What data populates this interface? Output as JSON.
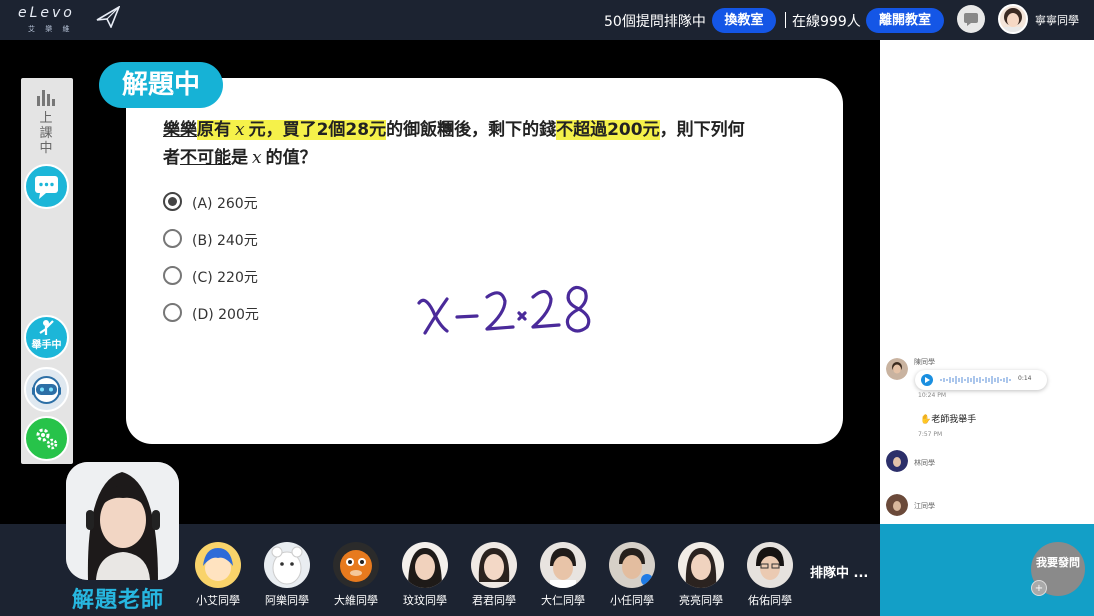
{
  "topbar": {
    "logo_text": "eLevo",
    "logo_sub": "艾 樂 維",
    "queue_text": "50個提問排隊中",
    "switch_button": "換教室",
    "online_text": "在線999人",
    "leave_button": "離開教室",
    "user_name": "寧寧同學"
  },
  "toolstrip": {
    "status_text": "上課中",
    "hand_label": "舉手中"
  },
  "question": {
    "badge": "解題中",
    "part1": "樂樂",
    "part2": "原有",
    "var1": "x",
    "part3": "元，買了",
    "part4": "2個28元",
    "part5": "的御飯糰後，剩下的錢",
    "part6": "不超過200元",
    "part7": "，則下列何",
    "part8": "者",
    "part9": "不可能",
    "part10": "是",
    "var2": "x",
    "part11": "的值？",
    "options": [
      {
        "label": "(A) 260元",
        "selected": true
      },
      {
        "label": "(B) 240元",
        "selected": false
      },
      {
        "label": "(C) 220元",
        "selected": false
      },
      {
        "label": "(D) 200元",
        "selected": false
      }
    ]
  },
  "chat": {
    "messages": [
      {
        "name": "陳同學",
        "time": "10:24 PM",
        "type": "voice",
        "duration": "0:14"
      },
      {
        "text": "老師我舉手",
        "time": "7:57 PM"
      },
      {
        "name": "林同學"
      },
      {
        "name": "江同學"
      }
    ],
    "ask_button": "我要發問",
    "ask_plus": "+"
  },
  "bottom": {
    "teacher_label": "解題老師",
    "students": [
      "小艾同學",
      "阿樂同學",
      "大維同學",
      "玟玟同學",
      "君君同學",
      "大仁同學",
      "小任同學",
      "亮亮同學",
      "佑佑同學"
    ],
    "queue_more": "排隊中 ..."
  },
  "colors": {
    "topbar": "#1c2331",
    "accent_blue": "#1456e6",
    "cyan": "#16b2d6",
    "highlight": "#f5f14a",
    "handwriting": "#4a2a9a"
  }
}
